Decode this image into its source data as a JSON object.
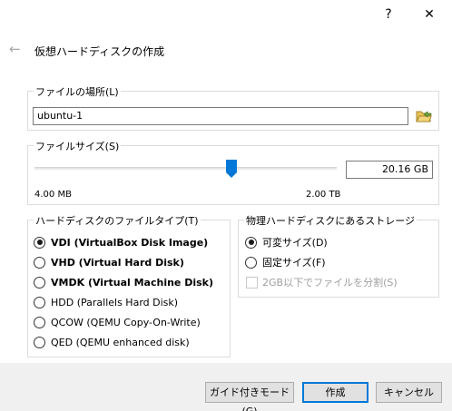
{
  "titlebar": {
    "help_label": "?",
    "close_label": "✕"
  },
  "header": {
    "back_icon": "←",
    "title": "仮想ハードディスクの作成"
  },
  "file_location": {
    "legend": "ファイルの場所(L)",
    "value": "ubuntu-1",
    "folder_icon": "folder-icon"
  },
  "file_size": {
    "legend": "ファイルサイズ(S)",
    "value": "20.16 GB",
    "min_label": "4.00 MB",
    "max_label": "2.00 TB",
    "slider_fraction": 0.65
  },
  "file_type": {
    "legend": "ハードディスクのファイルタイプ(T)",
    "options": [
      {
        "label": "VDI (VirtualBox Disk Image)",
        "checked": true,
        "bold": true
      },
      {
        "label": "VHD (Virtual Hard Disk)",
        "checked": false,
        "bold": true
      },
      {
        "label": "VMDK (Virtual Machine Disk)",
        "checked": false,
        "bold": true
      },
      {
        "label": "HDD (Parallels Hard Disk)",
        "checked": false,
        "bold": false
      },
      {
        "label": "QCOW (QEMU Copy-On-Write)",
        "checked": false,
        "bold": false
      },
      {
        "label": "QED (QEMU enhanced disk)",
        "checked": false,
        "bold": false
      }
    ]
  },
  "storage": {
    "legend": "物理ハードディスクにあるストレージ",
    "dynamic_label": "可変サイズ(D)",
    "fixed_label": "固定サイズ(F)",
    "split_label": "2GB以下でファイルを分割(S)"
  },
  "footer": {
    "guided_label": "ガイド付きモード(G)",
    "create_label": "作成",
    "cancel_label": "キャンセル"
  },
  "colors": {
    "accent": "#0078d7",
    "folder": "#6fa33e"
  }
}
